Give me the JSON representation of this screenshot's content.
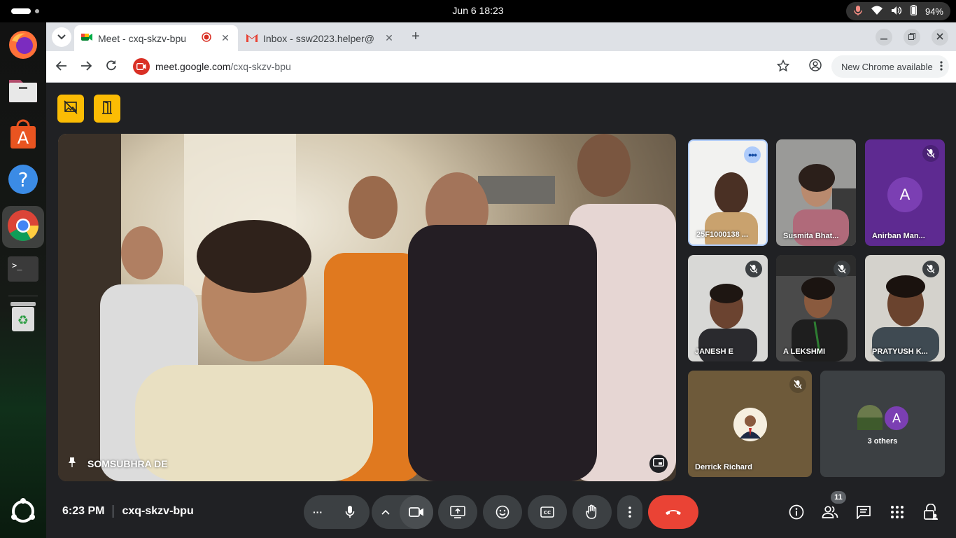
{
  "os": {
    "clock": "Jun 6  18:23",
    "battery": "94%"
  },
  "browser": {
    "tabs": [
      {
        "title": "Meet - cxq-skzv-bpu",
        "favicon": "google-meet-icon",
        "recording": true
      },
      {
        "title": "Inbox - ssw2023.helper@",
        "favicon": "gmail-icon"
      }
    ],
    "url_host": "meet.google.com",
    "url_path": "/cxq-skzv-bpu",
    "update_label": "New Chrome available"
  },
  "meet": {
    "main_speaker": "SOMSUBHRA DE",
    "participants": [
      {
        "name": "25F1000138 ...",
        "muted": false,
        "options": true
      },
      {
        "name": "Susmita Bhat...",
        "muted": false
      },
      {
        "name": "Anirban Man...",
        "muted": true,
        "avatar_letter": "A",
        "avatar_color": "#7b3fb3"
      },
      {
        "name": "JANESH E",
        "muted": true
      },
      {
        "name": "A LEKSHMI",
        "muted": true
      },
      {
        "name": "PRATYUSH K...",
        "muted": true
      },
      {
        "name": "Derrick Richard",
        "muted": true
      }
    ],
    "others": {
      "label": "3 others",
      "avatar_letter": "A"
    },
    "time": "6:23 PM",
    "meeting_code": "cxq-skzv-bpu",
    "people_count": "11"
  },
  "colors": {
    "accent_yellow": "#fbbc04",
    "hangup_red": "#ea4335",
    "meet_bg": "#202124"
  }
}
